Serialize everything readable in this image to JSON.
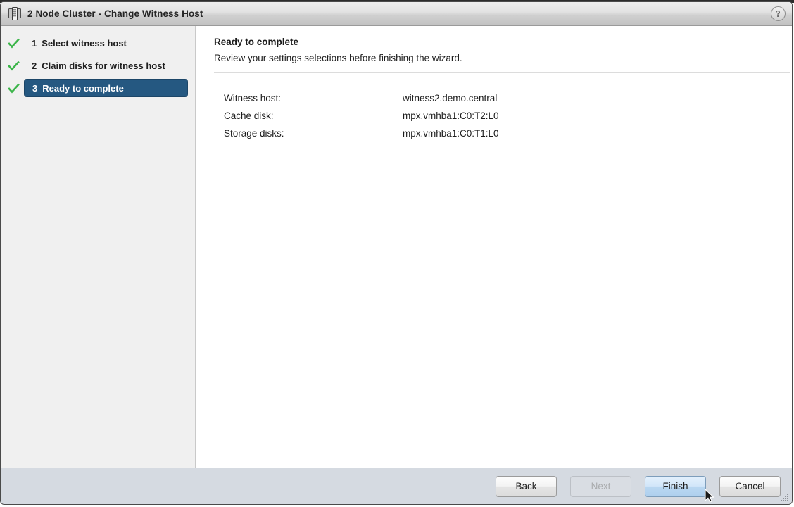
{
  "background_window": {
    "ghost_text_sliver": ""
  },
  "window": {
    "title": "2 Node Cluster - Change Witness Host",
    "icon": "cluster-icon",
    "help_label": "?"
  },
  "sidebar": {
    "steps": [
      {
        "number": "1",
        "label": "Select witness host",
        "state": "completed",
        "icon": "check-icon"
      },
      {
        "number": "2",
        "label": "Claim disks for witness host",
        "state": "completed",
        "icon": "check-icon"
      },
      {
        "number": "3",
        "label": "Ready to complete",
        "state": "current",
        "icon": "check-icon"
      }
    ]
  },
  "content": {
    "title": "Ready to complete",
    "subtitle": "Review your settings selections before finishing the wizard.",
    "summary": [
      {
        "key": "Witness host:",
        "value": "witness2.demo.central"
      },
      {
        "key": "Cache disk:",
        "value": "mpx.vmhba1:C0:T2:L0"
      },
      {
        "key": "Storage disks:",
        "value": "mpx.vmhba1:C0:T1:L0"
      }
    ]
  },
  "footer": {
    "buttons": [
      {
        "label": "Back",
        "state": "enabled"
      },
      {
        "label": "Next",
        "state": "disabled"
      },
      {
        "label": "Finish",
        "state": "primary"
      },
      {
        "label": "Cancel",
        "state": "enabled"
      }
    ],
    "resize_grip": "resize-grip-icon"
  },
  "colors": {
    "accent_step": "#255881",
    "check_green": "#3cb54a",
    "footer_bg": "#d5dae1",
    "sidebar_bg": "#f0f0f0",
    "primary_button": "#b9d7f1"
  }
}
